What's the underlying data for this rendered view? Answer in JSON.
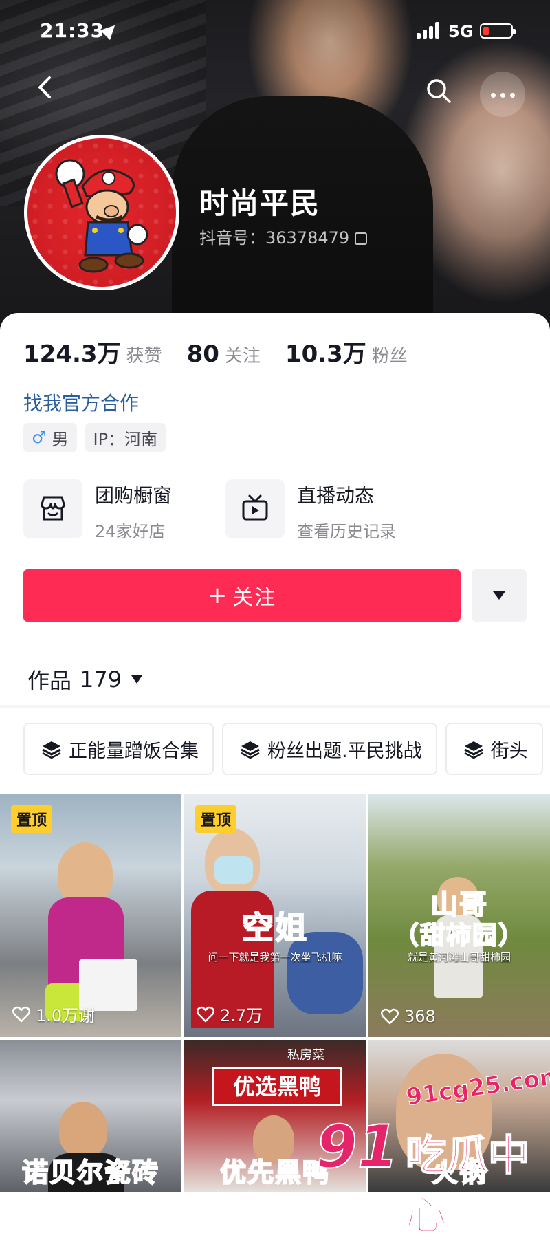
{
  "status_bar": {
    "time": "21:33",
    "network": "5G"
  },
  "profile": {
    "nickname": "时尚平民",
    "douyin_id": "抖音号：36378479",
    "stats": [
      {
        "num": "124.3万",
        "label": "获赞"
      },
      {
        "num": "80",
        "label": "关注"
      },
      {
        "num": "10.3万",
        "label": "粉丝"
      }
    ],
    "coop_link": "找我官方合作",
    "tags": {
      "gender": "男",
      "ip": "IP：河南"
    }
  },
  "features": [
    {
      "title": "团购橱窗",
      "sub": "24家好店",
      "icon": "storefront-icon"
    },
    {
      "title": "直播动态",
      "sub": "查看历史记录",
      "icon": "live-tv-icon"
    }
  ],
  "follow": {
    "plus": "+",
    "label": "关注"
  },
  "works": {
    "label": "作品",
    "count": "179"
  },
  "collections": [
    "正能量蹭饭合集",
    "粉丝出题.平民挑战",
    "街头"
  ],
  "videos": [
    {
      "pinned": "置顶",
      "likes": "1.0万谢"
    },
    {
      "pinned": "置顶",
      "likes": "2.7万",
      "title": "空姐",
      "sub": "问一下就是我第一次坐飞机嘛"
    },
    {
      "likes": "368",
      "title": "山哥",
      "title2": "（甜柿园）",
      "sub": "就是黄河滩山哥甜柿园"
    },
    {
      "title": "诺贝尔瓷砖"
    },
    {
      "title": "优先黑鸭",
      "sign": "优选黑鸭",
      "sign_sub": "私房菜"
    },
    {
      "title": "火锅"
    }
  ],
  "watermark": {
    "url": "91cg25.com",
    "big": "91",
    "cn": "吃瓜中心"
  }
}
